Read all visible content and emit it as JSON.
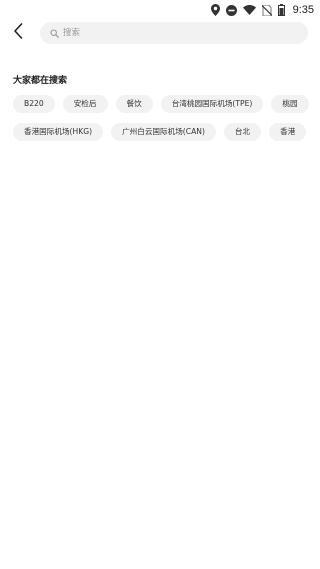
{
  "status_bar": {
    "time": "9:35",
    "icons": [
      "location-icon",
      "do-not-disturb-icon",
      "wifi-icon",
      "no-sim-icon",
      "battery-icon"
    ]
  },
  "header": {
    "back_icon": "chevron-left-icon",
    "search": {
      "icon": "search-icon",
      "placeholder": "搜索",
      "value": ""
    }
  },
  "popular_searches": {
    "title": "大家都在搜索",
    "rows": [
      [
        "B220",
        "安检后",
        "餐饮",
        "台湾桃园国际机场(TPE)",
        "桃园"
      ],
      [
        "香港国际机场(HKG)",
        "广州白云国际机场(CAN)",
        "台北",
        "香港"
      ]
    ]
  },
  "colors": {
    "background": "#ffffff",
    "chip_background": "#f2f2f2",
    "text_primary": "#222222",
    "placeholder": "#9a9a9a"
  }
}
